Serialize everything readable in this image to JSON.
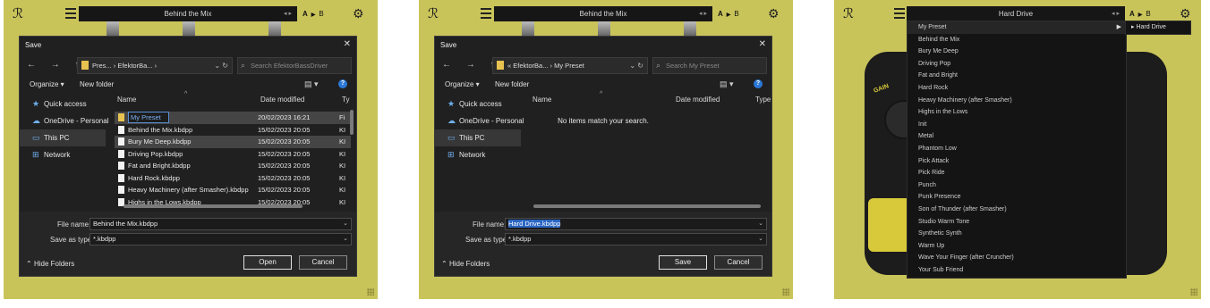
{
  "colors": {
    "panel_bg": "#c9c45a",
    "dialog_bg": "#202020",
    "accent_blue": "#2a65c2",
    "folder_yellow": "#e8c250"
  },
  "topbar": {
    "logo_icon": "logo-glyph-icon",
    "menu_icon": "hamburger-icon",
    "ab_a": "A",
    "ab_b": "B",
    "ab_arrow": "▶",
    "preset_arrows": "◂ ▸",
    "gear_icon": "gear-icon"
  },
  "panels": [
    {
      "preset_name": "Behind the Mix"
    },
    {
      "preset_name": "Behind the Mix"
    },
    {
      "preset_name": "Hard Drive"
    }
  ],
  "dialog1": {
    "title": "Save",
    "close": "✕",
    "nav": "← → ↑",
    "path": "Pres... › EfektorBa... ›",
    "search_placeholder": "Search EfektorBassDriver",
    "organize": "Organize ▾",
    "new_folder": "New folder",
    "sidebar": [
      {
        "label": "Quick access",
        "icon": "star-icon"
      },
      {
        "label": "OneDrive - Personal",
        "icon": "cloud-icon"
      },
      {
        "label": "This PC",
        "icon": "pc-icon"
      },
      {
        "label": "Network",
        "icon": "network-icon"
      }
    ],
    "columns": {
      "name": "Name",
      "date": "Date modified",
      "type": "Ty"
    },
    "rows": [
      {
        "name": "My Preset",
        "date": "20/02/2023 16:21",
        "type": "Fi",
        "folder": true
      },
      {
        "name": "Behind the Mix.kbdpp",
        "date": "15/02/2023 20:05",
        "type": "KI"
      },
      {
        "name": "Bury Me Deep.kbdpp",
        "date": "15/02/2023 20:05",
        "type": "KI"
      },
      {
        "name": "Driving Pop.kbdpp",
        "date": "15/02/2023 20:05",
        "type": "KI"
      },
      {
        "name": "Fat and Bright.kbdpp",
        "date": "15/02/2023 20:05",
        "type": "KI"
      },
      {
        "name": "Hard Rock.kbdpp",
        "date": "15/02/2023 20:05",
        "type": "KI"
      },
      {
        "name": "Heavy Machinery (after Smasher).kbdpp",
        "date": "15/02/2023 20:05",
        "type": "KI"
      },
      {
        "name": "Highs in the Lows.kbdpp",
        "date": "15/02/2023 20:05",
        "type": "KI"
      }
    ],
    "file_name_label": "File name:",
    "file_name": "Behind the Mix.kbdpp",
    "save_type_label": "Save as type:",
    "save_type": "*.kbdpp",
    "hide_folders": "Hide Folders",
    "primary": "Open",
    "cancel": "Cancel"
  },
  "dialog2": {
    "title": "Save",
    "close": "✕",
    "nav": "← → ↑",
    "path": "« EfektorBa... › My Preset",
    "search_placeholder": "Search My Preset",
    "organize": "Organize ▾",
    "new_folder": "New folder",
    "sidebar": [
      {
        "label": "Quick access",
        "icon": "star-icon"
      },
      {
        "label": "OneDrive - Personal",
        "icon": "cloud-icon"
      },
      {
        "label": "This PC",
        "icon": "pc-icon"
      },
      {
        "label": "Network",
        "icon": "network-icon"
      }
    ],
    "columns": {
      "name": "Name",
      "date": "Date modified",
      "type": "Type"
    },
    "empty": "No items match your search.",
    "file_name_label": "File name:",
    "file_name": "Hard Drive.kbdpp",
    "save_type_label": "Save as type:",
    "save_type": "*.kbdpp",
    "hide_folders": "Hide Folders",
    "primary": "Save",
    "cancel": "Cancel"
  },
  "menu": {
    "items": [
      "My Preset",
      "Behind the Mix",
      "Bury Me Deep",
      "Driving Pop",
      "Fat and Bright",
      "Hard Rock",
      "Heavy Machinery (after Smasher)",
      "Highs in the Lows",
      "Init",
      "Metal",
      "Phantom Low",
      "Pick Attack",
      "Pick Ride",
      "Punch",
      "Punk Presence",
      "Son of Thunder (after Smasher)",
      "Studio Warm Tone",
      "Synthetic Synth",
      "Warm Up",
      "Wave Your Finger (after Cruncher)",
      "Your Sub Friend"
    ],
    "submenu_arrow": "▶",
    "submenu_item": "▸ Hard Drive"
  },
  "pedal": {
    "gain_label": "GAIN"
  }
}
